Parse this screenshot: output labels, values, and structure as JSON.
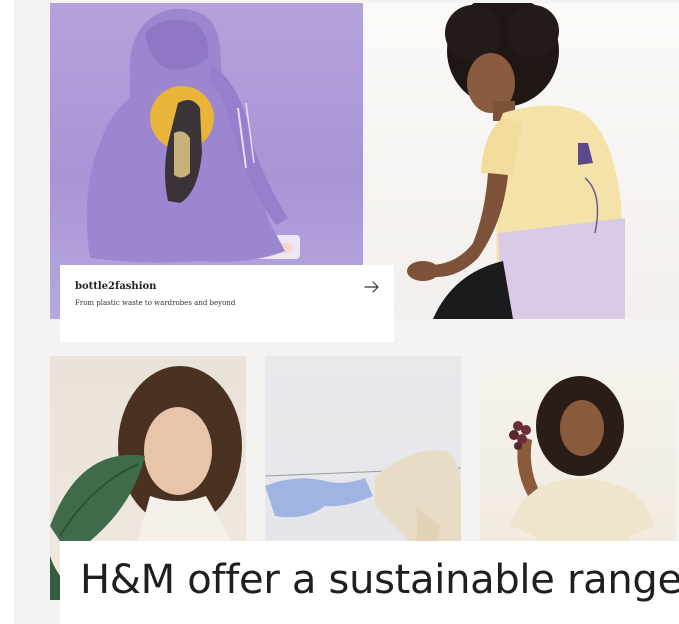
{
  "feature_card": {
    "title": "bottle2fashion",
    "subtitle": "From plastic waste to wardrobes and beyond",
    "arrow_icon": "arrow-right-icon"
  },
  "overlay_caption": {
    "text": "H&M offer a sustainable range"
  },
  "colors": {
    "hero_left_bg": "#a895d6",
    "hoodie": "#9d86d0",
    "caption_text": "#222222",
    "overlay_text": "#1f1f1f"
  }
}
